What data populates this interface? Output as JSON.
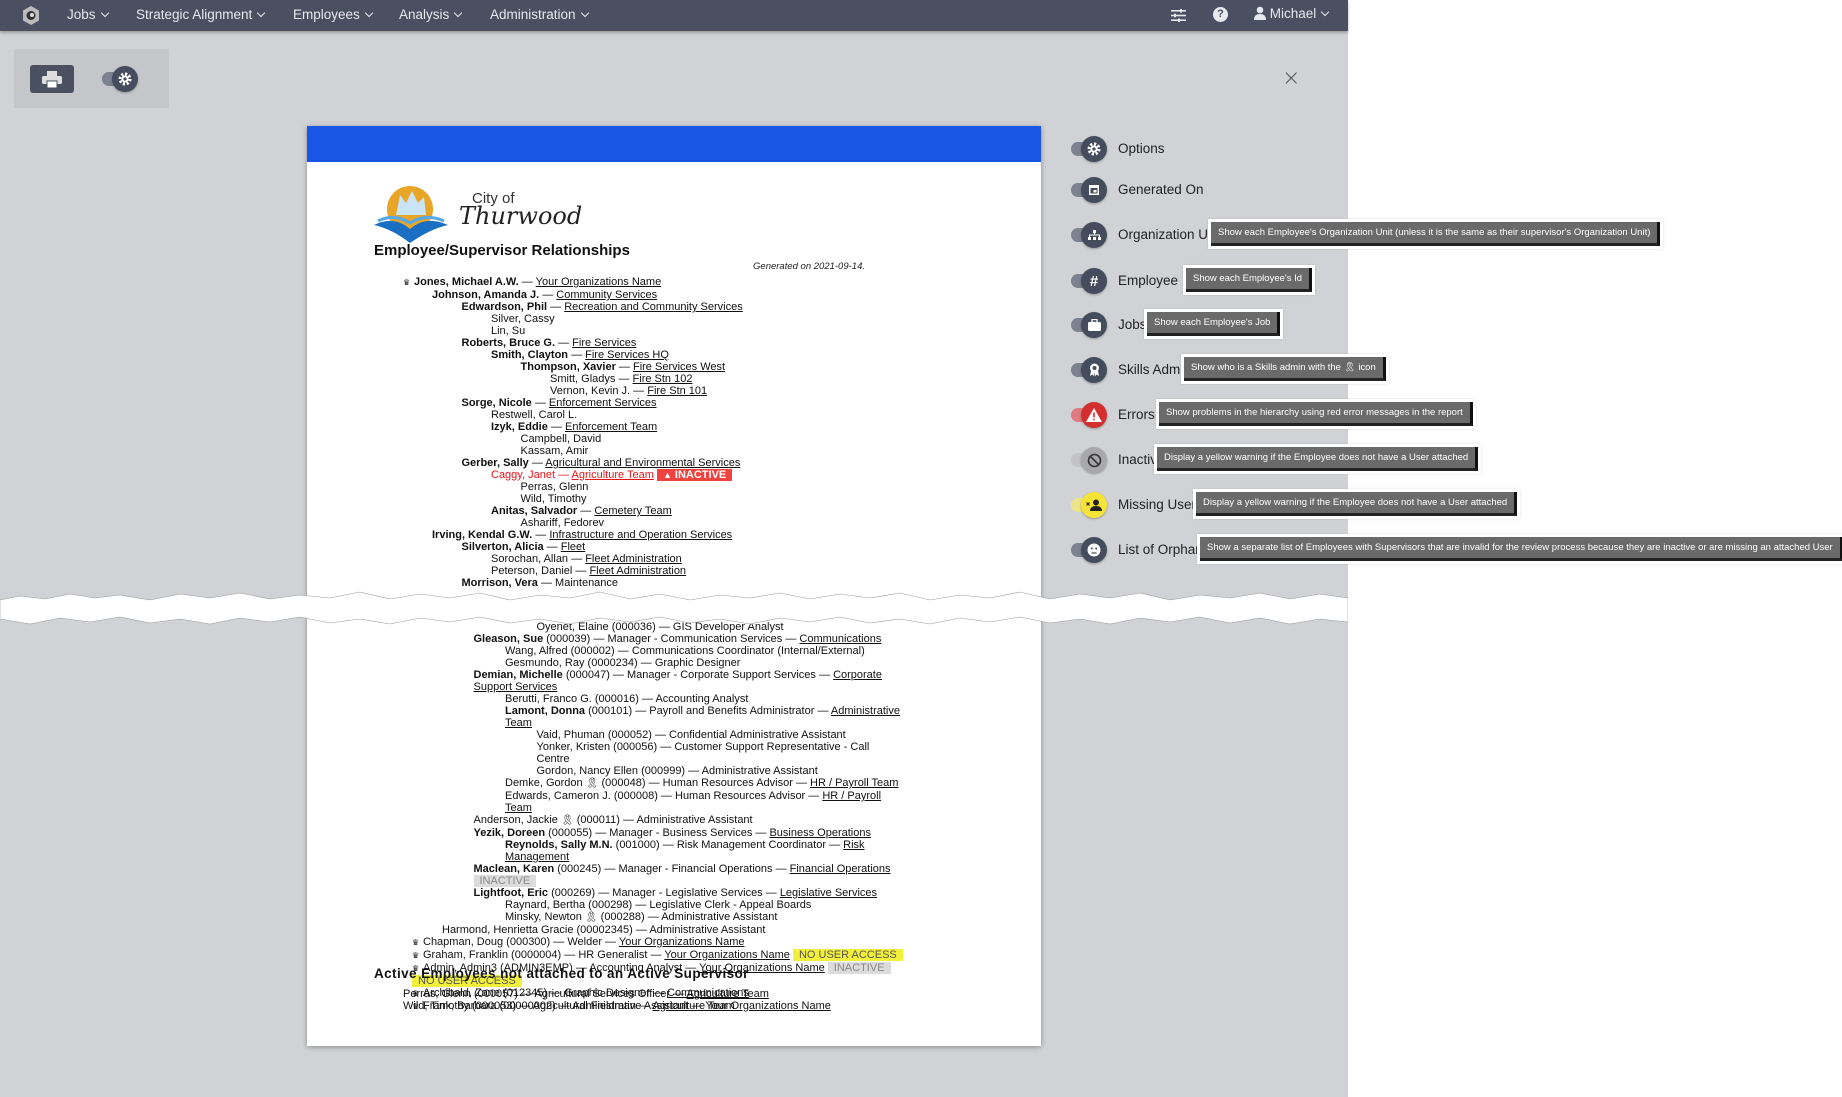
{
  "nav": {
    "items": [
      "Jobs",
      "Strategic Alignment",
      "Employees",
      "Analysis",
      "Administration"
    ],
    "user": "Michael"
  },
  "toolbar": {
    "print_icon": "printer-icon",
    "settings_icon": "gear-icon"
  },
  "close_label": "×",
  "colors": {
    "nav": "#4a5061",
    "accent": "#1a56e6",
    "error": "#f0433f",
    "warning": "#f2f03a"
  },
  "report": {
    "city_of": "City of",
    "city_name": "Thurwood",
    "title": "Employee/Supervisor Relationships",
    "generated": "Generated on 2021-09-14.",
    "tree_top": [
      {
        "l": 0,
        "crown": true,
        "name": "Jones, Michael A.W.",
        "bold": true,
        "org": "Your Organizations Name"
      },
      {
        "l": 1,
        "name": "Johnson, Amanda J.",
        "bold": true,
        "org": "Community Services"
      },
      {
        "l": 2,
        "name": "Edwardson, Phil",
        "bold": true,
        "org": "Recreation and Community Services"
      },
      {
        "l": 3,
        "name": "Silver, Cassy"
      },
      {
        "l": 3,
        "name": "Lin, Su"
      },
      {
        "l": 2,
        "name": "Roberts, Bruce G.",
        "bold": true,
        "org": "Fire Services"
      },
      {
        "l": 3,
        "name": "Smith, Clayton",
        "bold": true,
        "org": "Fire Services HQ"
      },
      {
        "l": 4,
        "name": "Thompson, Xavier",
        "bold": true,
        "org": "Fire Services West"
      },
      {
        "l": 5,
        "name": "Smitt, Gladys",
        "org": "Fire Stn 102"
      },
      {
        "l": 5,
        "name": "Vernon, Kevin J.",
        "org": "Fire Stn 101"
      },
      {
        "l": 2,
        "name": "Sorge, Nicole",
        "bold": true,
        "org": "Enforcement Services"
      },
      {
        "l": 3,
        "name": "Restwell, Carol L."
      },
      {
        "l": 3,
        "name": "Izyk, Eddie",
        "bold": true,
        "org": "Enforcement Team"
      },
      {
        "l": 4,
        "name": "Campbell, David"
      },
      {
        "l": 4,
        "name": "Kassam, Amir"
      },
      {
        "l": 2,
        "name": "Gerber, Sally",
        "bold": true,
        "org": "Agricultural and Environmental Services"
      },
      {
        "l": 3,
        "name": "Caggy, Janet",
        "error": true,
        "org": "Agriculture Team",
        "badges": [
          {
            "text": "INACTIVE",
            "type": "red"
          }
        ]
      },
      {
        "l": 4,
        "name": "Perras, Glenn"
      },
      {
        "l": 4,
        "name": "Wild, Timothy"
      },
      {
        "l": 3,
        "name": "Anitas, Salvador",
        "bold": true,
        "org": "Cemetery Team"
      },
      {
        "l": 4,
        "name": "Ashariff, Fedorev"
      },
      {
        "l": 1,
        "name": "Irving, Kendal G.W.",
        "bold": true,
        "org": "Infrastructure and Operation Services"
      },
      {
        "l": 2,
        "name": "Silverton, Alicia",
        "bold": true,
        "org": "Fleet"
      },
      {
        "l": 3,
        "name": "Sorochan, Allan",
        "org": "Fleet Administration"
      },
      {
        "l": 3,
        "name": "Peterson, Daniel",
        "org": "Fleet Administration"
      },
      {
        "l": 2,
        "name": "Morrison, Vera",
        "bold": true,
        "plain": "Maintenance"
      }
    ],
    "tree_bottom": [
      {
        "l": 4,
        "name": "Oyenet, Elaine",
        "id": "(000036)",
        "job": "GIS Developer Analyst"
      },
      {
        "l": 2,
        "name": "Gleason, Sue",
        "bold": true,
        "id": "(000039)",
        "job": "Manager - Communication Services",
        "org": "Communications"
      },
      {
        "l": 3,
        "name": "Wang, Alfred",
        "id": "(000002)",
        "job": "Communications Coordinator (Internal/External)"
      },
      {
        "l": 3,
        "name": "Gesmundo, Ray",
        "id": "(0000234)",
        "job": "Graphic Designer"
      },
      {
        "l": 2,
        "name": "Demian, Michelle",
        "bold": true,
        "id": "(000047)",
        "job": "Manager - Corporate Support Services",
        "org": "Corporate Support Services"
      },
      {
        "l": 3,
        "name": "Berutti, Franco G.",
        "id": "(000016)",
        "job": "Accounting Analyst"
      },
      {
        "l": 3,
        "name": "Lamont, Donna",
        "bold": true,
        "id": "(000101)",
        "job": "Payroll and Benefits Administrator",
        "org": "Administrative Team"
      },
      {
        "l": 4,
        "name": "Vaid, Phuman",
        "id": "(000052)",
        "job": "Confidential Administrative Assistant"
      },
      {
        "l": 4,
        "name": "Yonker, Kristen",
        "id": "(000056)",
        "job": "Customer Support Representative - Call Centre"
      },
      {
        "l": 4,
        "name": "Gordon, Nancy Ellen",
        "id": "(000999)",
        "job": "Administrative Assistant"
      },
      {
        "l": 3,
        "name": "Demke, Gordon",
        "skills": true,
        "id": "(000048)",
        "job": "Human Resources Advisor",
        "org": "HR / Payroll Team"
      },
      {
        "l": 3,
        "name": "Edwards, Cameron J.",
        "id": "(000008)",
        "job": "Human Resources Advisor",
        "org": "HR / Payroll Team"
      },
      {
        "l": 2,
        "name": "Anderson, Jackie",
        "skills": true,
        "id": "(000011)",
        "job": "Administrative Assistant"
      },
      {
        "l": 2,
        "name": "Yezik, Doreen",
        "bold": true,
        "id": "(000055)",
        "job": "Manager - Business Services",
        "org": "Business Operations"
      },
      {
        "l": 3,
        "name": "Reynolds, Sally M.N.",
        "bold": true,
        "id": "(001000)",
        "job": "Risk Management Coordinator",
        "org": "Risk Management"
      },
      {
        "l": 2,
        "name": "Maclean, Karen",
        "bold": true,
        "id": "(000245)",
        "job": "Manager - Financial Operations",
        "org": "Financial Operations",
        "badges": [
          {
            "text": "INACTIVE",
            "type": "grey"
          }
        ]
      },
      {
        "l": 2,
        "name": "Lightfoot, Eric",
        "bold": true,
        "id": "(000269)",
        "job": "Manager - Legislative Services",
        "org": "Legislative Services"
      },
      {
        "l": 3,
        "name": "Raynard, Bertha",
        "id": "(000298)",
        "job": "Legislative Clerk - Appeal Boards"
      },
      {
        "l": 3,
        "name": "Minsky, Newton",
        "skills": true,
        "id": "(000288)",
        "job": "Administrative Assistant"
      },
      {
        "l": 1,
        "name": "Harmond, Henrietta Gracie",
        "id": "(00002345)",
        "job": "Administrative Assistant"
      },
      {
        "l": 0,
        "crown": true,
        "name": "Chapman, Doug",
        "id": "(000300)",
        "job": "Welder",
        "org": "Your Organizations Name"
      },
      {
        "l": 0,
        "crown": true,
        "name": "Graham, Franklin",
        "id": "(0000004)",
        "job": "HR Generalist",
        "org": "Your Organizations Name",
        "badges": [
          {
            "text": "NO USER ACCESS",
            "type": "yellow"
          }
        ]
      },
      {
        "l": 0,
        "crown": true,
        "name": "Admin, Admin3",
        "id": "(ADMIN3EMP)",
        "job": "Accounting Analyst",
        "org": "Your Organizations Name",
        "badges": [
          {
            "text": "INACTIVE",
            "type": "grey"
          },
          {
            "text": "NO USER ACCESS",
            "type": "yellow"
          }
        ]
      },
      {
        "l": 0,
        "crown": true,
        "name": "Archibald, Zane",
        "id": "(012345)",
        "job": "Graphic Designer",
        "org": "Communications"
      },
      {
        "l": 0,
        "crown": true,
        "name": "Frank, Barbara",
        "id": "(00000002)",
        "job": "Administrative Assistant",
        "org": "Your Organizations Name"
      }
    ],
    "orphans_title": "Active Employees not attached to an Active Supervisor",
    "orphans": [
      {
        "name": "Perras, Glenn",
        "id": "(000057)",
        "job": "Agricultural Services Officer",
        "org": "Agriculture Team"
      },
      {
        "name": "Wild, Timothy",
        "id": "(000053)",
        "job": "Agricultural Fieldman",
        "org": "Agriculture Team"
      }
    ]
  },
  "options": [
    {
      "label": "Options",
      "icon": "gear-icon",
      "state": "on"
    },
    {
      "label": "Generated On",
      "icon": "calendar-icon",
      "state": "on"
    },
    {
      "label": "Organization Units",
      "icon": "sitemap-icon",
      "state": "on",
      "tip": "Show each Employee's Organization Unit (unless it is the same as their supervisor's Organization Unit)"
    },
    {
      "label": "Employee Id",
      "icon": "hash-icon",
      "state": "on",
      "tip": "Show each Employee's Id"
    },
    {
      "label": "Jobs",
      "icon": "briefcase-icon",
      "state": "on",
      "tip": "Show each Employee's Job"
    },
    {
      "label": "Skills Admins",
      "icon": "award-icon",
      "state": "on",
      "tip_pre": "Show who is a Skills admin with the",
      "tip_post": "icon"
    },
    {
      "label": "Errors",
      "icon": "warning-icon",
      "state": "error",
      "tip": "Show problems in the hierarchy using red error messages in the report"
    },
    {
      "label": "Inactive",
      "icon": "ban-icon",
      "state": "off",
      "tip": "Display a yellow warning if the Employee does not have a User attached"
    },
    {
      "label": "Missing User Id",
      "icon": "user-x-icon",
      "state": "warn",
      "tip": "Display a yellow warning if the Employee does not have a User attached"
    },
    {
      "label": "List of Orphans",
      "icon": "face-icon",
      "state": "on",
      "tip": "Show a separate list of Employees with Supervisors that are invalid for the review process because they are inactive or are missing an attached User"
    }
  ]
}
